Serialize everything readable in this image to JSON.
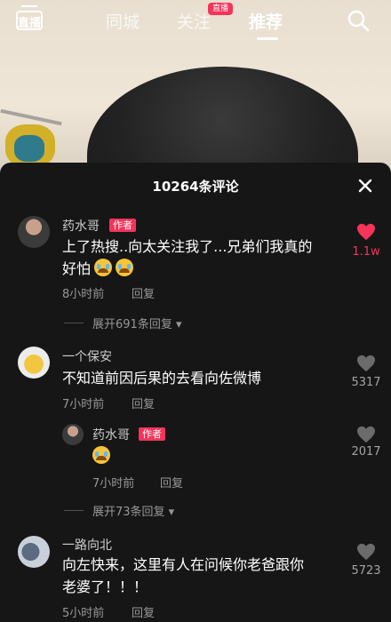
{
  "topnav": {
    "live_label": "直播",
    "tabs": [
      "同城",
      "关注",
      "推荐"
    ],
    "live_badge": "直播"
  },
  "panel": {
    "title": "10264条评论"
  },
  "comments": [
    {
      "user": "药水哥",
      "tag": "作者",
      "text_line1": "上了热搜..向太关注我了...兄弟们我真的",
      "text_line2": "好怕",
      "time": "8小时前",
      "reply": "回复",
      "likes": "1.1w",
      "liked": true,
      "expand": "展开691条回复"
    },
    {
      "user": "一个保安",
      "text_line1": "不知道前因后果的去看向佐微博",
      "time": "7小时前",
      "reply": "回复",
      "likes": "5317"
    },
    {
      "user": "药水哥",
      "tag": "作者",
      "time": "7小时前",
      "reply": "回复",
      "likes": "2017",
      "expand": "展开73条回复"
    },
    {
      "user": "一路向北",
      "text_line1": "向左快来，这里有人在问候你老爸跟你",
      "text_line2": "老婆了！！！",
      "time": "5小时前",
      "reply": "回复",
      "likes": "5723"
    }
  ],
  "colors": {
    "accent": "#f5345a",
    "panel_bg": "#161616"
  }
}
